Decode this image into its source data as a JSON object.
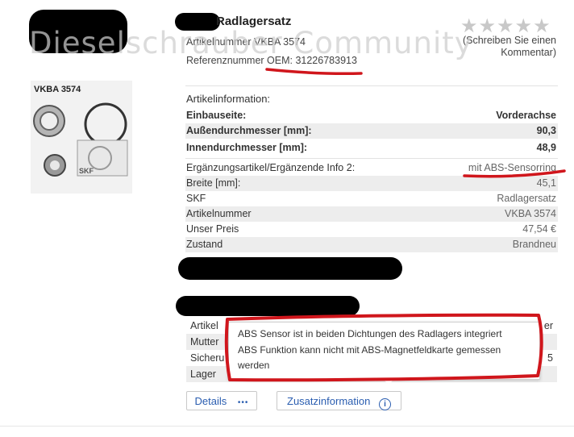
{
  "watermark": "Dieselschrauber Community",
  "product": {
    "title": "Radlagersatz",
    "article_number_line": "Artikelnummer VKBA 3574",
    "reference_line": "Referenznummer OEM: 31226783913",
    "image_code": "VKBA 3574",
    "image_brand": "SKF"
  },
  "rating": {
    "stars": "★★★★★",
    "review_link": "(Schreiben Sie einen Kommentar)"
  },
  "specs": {
    "heading": "Artikelinformation:",
    "rows": [
      {
        "label": "Einbauseite:",
        "value": "Vorderachse"
      },
      {
        "label": "Außendurchmesser [mm]:",
        "value": "90,3"
      },
      {
        "label": "Innendurchmesser [mm]:",
        "value": "48,9"
      },
      {
        "label": "Ergänzungsartikel/Ergänzende Info 2:",
        "value": "mit ABS-Sensorring"
      },
      {
        "label": "Breite [mm]:",
        "value": "45,1"
      },
      {
        "label": "SKF",
        "value": "Radlagersatz"
      },
      {
        "label": "Artikelnummer",
        "value": "VKBA 3574"
      },
      {
        "label": "Unser Preis",
        "value": "47,54 €"
      },
      {
        "label": "Zustand",
        "value": "Brandneu"
      }
    ]
  },
  "info_table": {
    "rows": [
      {
        "label": "Artikel",
        "tail": "er"
      },
      {
        "label": "Mutter",
        "tail": ""
      },
      {
        "label": "Sicheru",
        "tail": "5"
      },
      {
        "label": "Lager",
        "tail": ""
      }
    ]
  },
  "tooltip": {
    "line1": "ABS Sensor ist in beiden Dichtungen des Radlagers integriert",
    "line2": "ABS Funktion kann nicht mit ABS-Magnetfeldkarte gemessen werden"
  },
  "buttons": {
    "details_label": "Details",
    "details_icon": "•••",
    "extra_label": "Zusatzinformation",
    "extra_icon": "info-icon"
  },
  "colors": {
    "accent": "#2a5db0",
    "annotation": "#d0161c"
  }
}
